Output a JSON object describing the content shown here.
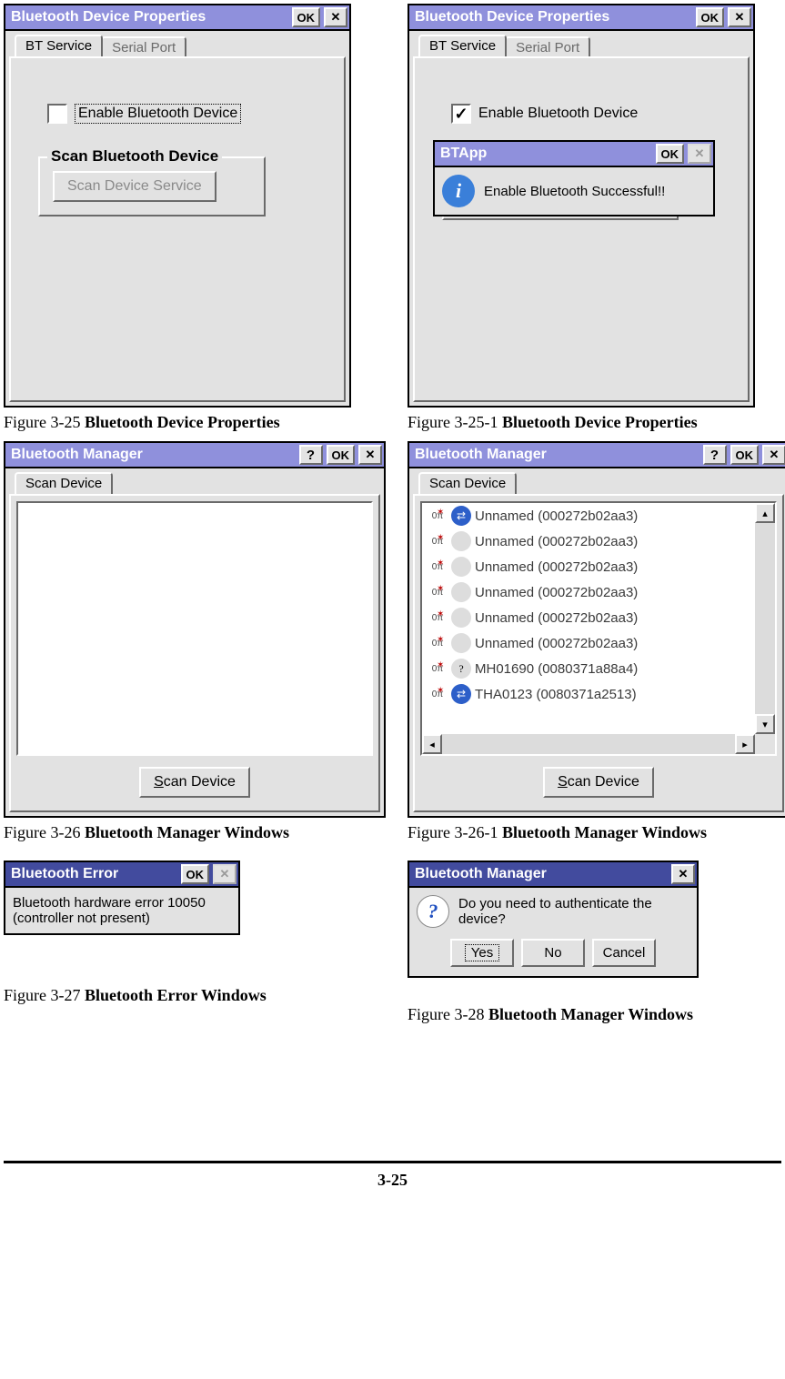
{
  "captions": {
    "f1": {
      "pre": "Figure 3-25 ",
      "bold": "Bluetooth Device Properties"
    },
    "f2": {
      "pre": "Figure 3-25-1 ",
      "bold": "Bluetooth Device Properties"
    },
    "f3": {
      "pre": "Figure 3-26 ",
      "bold": "Bluetooth Manager Windows"
    },
    "f4": {
      "pre": "Figure 3-26-1 ",
      "bold": "Bluetooth Manager Windows"
    },
    "f5": {
      "pre": "Figure 3-27 ",
      "bold": "Bluetooth Error Windows"
    },
    "f6": {
      "pre": "Figure 3-28 ",
      "bold": "Bluetooth Manager Windows"
    }
  },
  "props": {
    "title": "Bluetooth Device Properties",
    "ok": "OK",
    "tabs": {
      "bt": "BT Service",
      "serial": "Serial Port"
    },
    "enable": "Enable Bluetooth Device",
    "groupTitle": "Scan Bluetooth Device",
    "scanService": "Scan Device Service"
  },
  "btapp": {
    "title": "BTApp",
    "ok": "OK",
    "msg": "Enable Bluetooth Successful!!"
  },
  "mgr": {
    "title": "Bluetooth Manager",
    "ok": "OK",
    "tab": "Scan Device",
    "scan": "Scan Device",
    "list": [
      {
        "svc": "net",
        "label": "Unnamed (000272b02aa3)"
      },
      {
        "svc": "key",
        "label": "Unnamed (000272b02aa3)"
      },
      {
        "svc": "card",
        "label": "Unnamed (000272b02aa3)"
      },
      {
        "svc": "card",
        "label": "Unnamed (000272b02aa3)"
      },
      {
        "svc": "print",
        "label": "Unnamed (000272b02aa3)"
      },
      {
        "svc": "pc",
        "label": "Unnamed (000272b02aa3)"
      },
      {
        "svc": "unk",
        "label": "MH01690 (0080371a88a4)"
      },
      {
        "svc": "net",
        "label": "THA0123 (0080371a2513)"
      }
    ]
  },
  "err": {
    "title": "Bluetooth Error",
    "ok": "OK",
    "msg": "Bluetooth hardware error 10050 (controller not present)"
  },
  "auth": {
    "title": "Bluetooth Manager",
    "msg": "Do you need to authenticate the device?",
    "yes": "Yes",
    "no": "No",
    "cancel": "Cancel"
  },
  "page": "3-25"
}
